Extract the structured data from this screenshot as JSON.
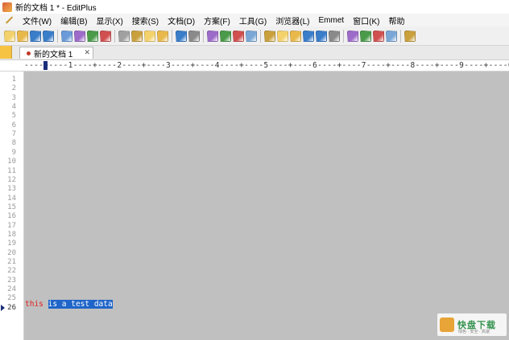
{
  "window": {
    "title": "新的文档 1 * - EditPlus"
  },
  "menubar": {
    "items": [
      {
        "label": "文件(W)"
      },
      {
        "label": "编辑(B)"
      },
      {
        "label": "显示(X)"
      },
      {
        "label": "搜索(S)"
      },
      {
        "label": "文档(D)"
      },
      {
        "label": "方案(F)"
      },
      {
        "label": "工具(G)"
      },
      {
        "label": "浏览器(L)"
      },
      {
        "label": "Emmet"
      },
      {
        "label": "窗口(K)"
      },
      {
        "label": "帮助"
      }
    ]
  },
  "toolbar": {
    "icons": [
      "new-file-icon",
      "open-folder-icon",
      "save-icon",
      "save-all-icon",
      "sep",
      "print-preview-icon",
      "print-icon",
      "spellcheck-icon",
      "browser-icon",
      "sep",
      "cut-icon",
      "copy-icon",
      "paste-icon",
      "delete-icon",
      "sep",
      "undo-icon",
      "redo-icon",
      "sep",
      "find-icon",
      "replace-icon",
      "find-in-files-icon",
      "goto-line-icon",
      "sep",
      "font-icon",
      "hex-icon",
      "word-wrap-icon",
      "ruler-icon",
      "line-number-icon",
      "settings-icon",
      "sep",
      "window-icon",
      "window-split-icon",
      "cliptext-icon",
      "directory-icon",
      "sep",
      "help-icon"
    ]
  },
  "tabs": [
    {
      "label": "新的文档 1",
      "close": "✕"
    }
  ],
  "ruler": {
    "text": "----+----1----+----2----+----3----+----4----+----5----+----6----+----7----+----8----+----9----+----0----+"
  },
  "editor": {
    "line_numbers": [
      "1",
      "2",
      "3",
      "4",
      "5",
      "6",
      "7",
      "8",
      "9",
      "10",
      "11",
      "12",
      "13",
      "14",
      "15",
      "16",
      "17",
      "18",
      "19",
      "20",
      "21",
      "22",
      "23",
      "24",
      "25",
      "26"
    ],
    "current_line": 26,
    "code": {
      "word1": "this",
      "space": " ",
      "selected": "is a test data"
    }
  },
  "watermark": {
    "text": "快盘下载",
    "sub": "绿色 · 安全 · 高速"
  }
}
